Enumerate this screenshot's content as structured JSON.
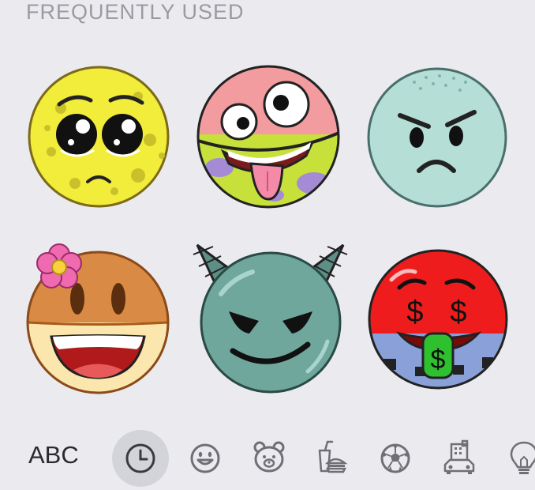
{
  "section": {
    "title": "FREQUENTLY USED"
  },
  "stickers": [
    {
      "name": "pleading-sponge-face"
    },
    {
      "name": "tongue-out-starfish-face"
    },
    {
      "name": "angry-squid-face"
    },
    {
      "name": "grinning-flower-face"
    },
    {
      "name": "smirking-devil-face"
    },
    {
      "name": "money-mouth-crab-face"
    }
  ],
  "keyboard": {
    "abc_label": "ABC",
    "categories": [
      {
        "icon": "clock-icon",
        "active": true
      },
      {
        "icon": "smiley-icon",
        "active": false
      },
      {
        "icon": "bear-icon",
        "active": false
      },
      {
        "icon": "food-icon",
        "active": false
      },
      {
        "icon": "soccer-ball-icon",
        "active": false
      },
      {
        "icon": "building-car-icon",
        "active": false
      },
      {
        "icon": "lightbulb-icon",
        "active": false
      }
    ]
  },
  "colors": {
    "background": "#ebebef",
    "title": "#9a9aa0",
    "active_tab": "#d3d4da",
    "icon": "#6f6f75"
  }
}
